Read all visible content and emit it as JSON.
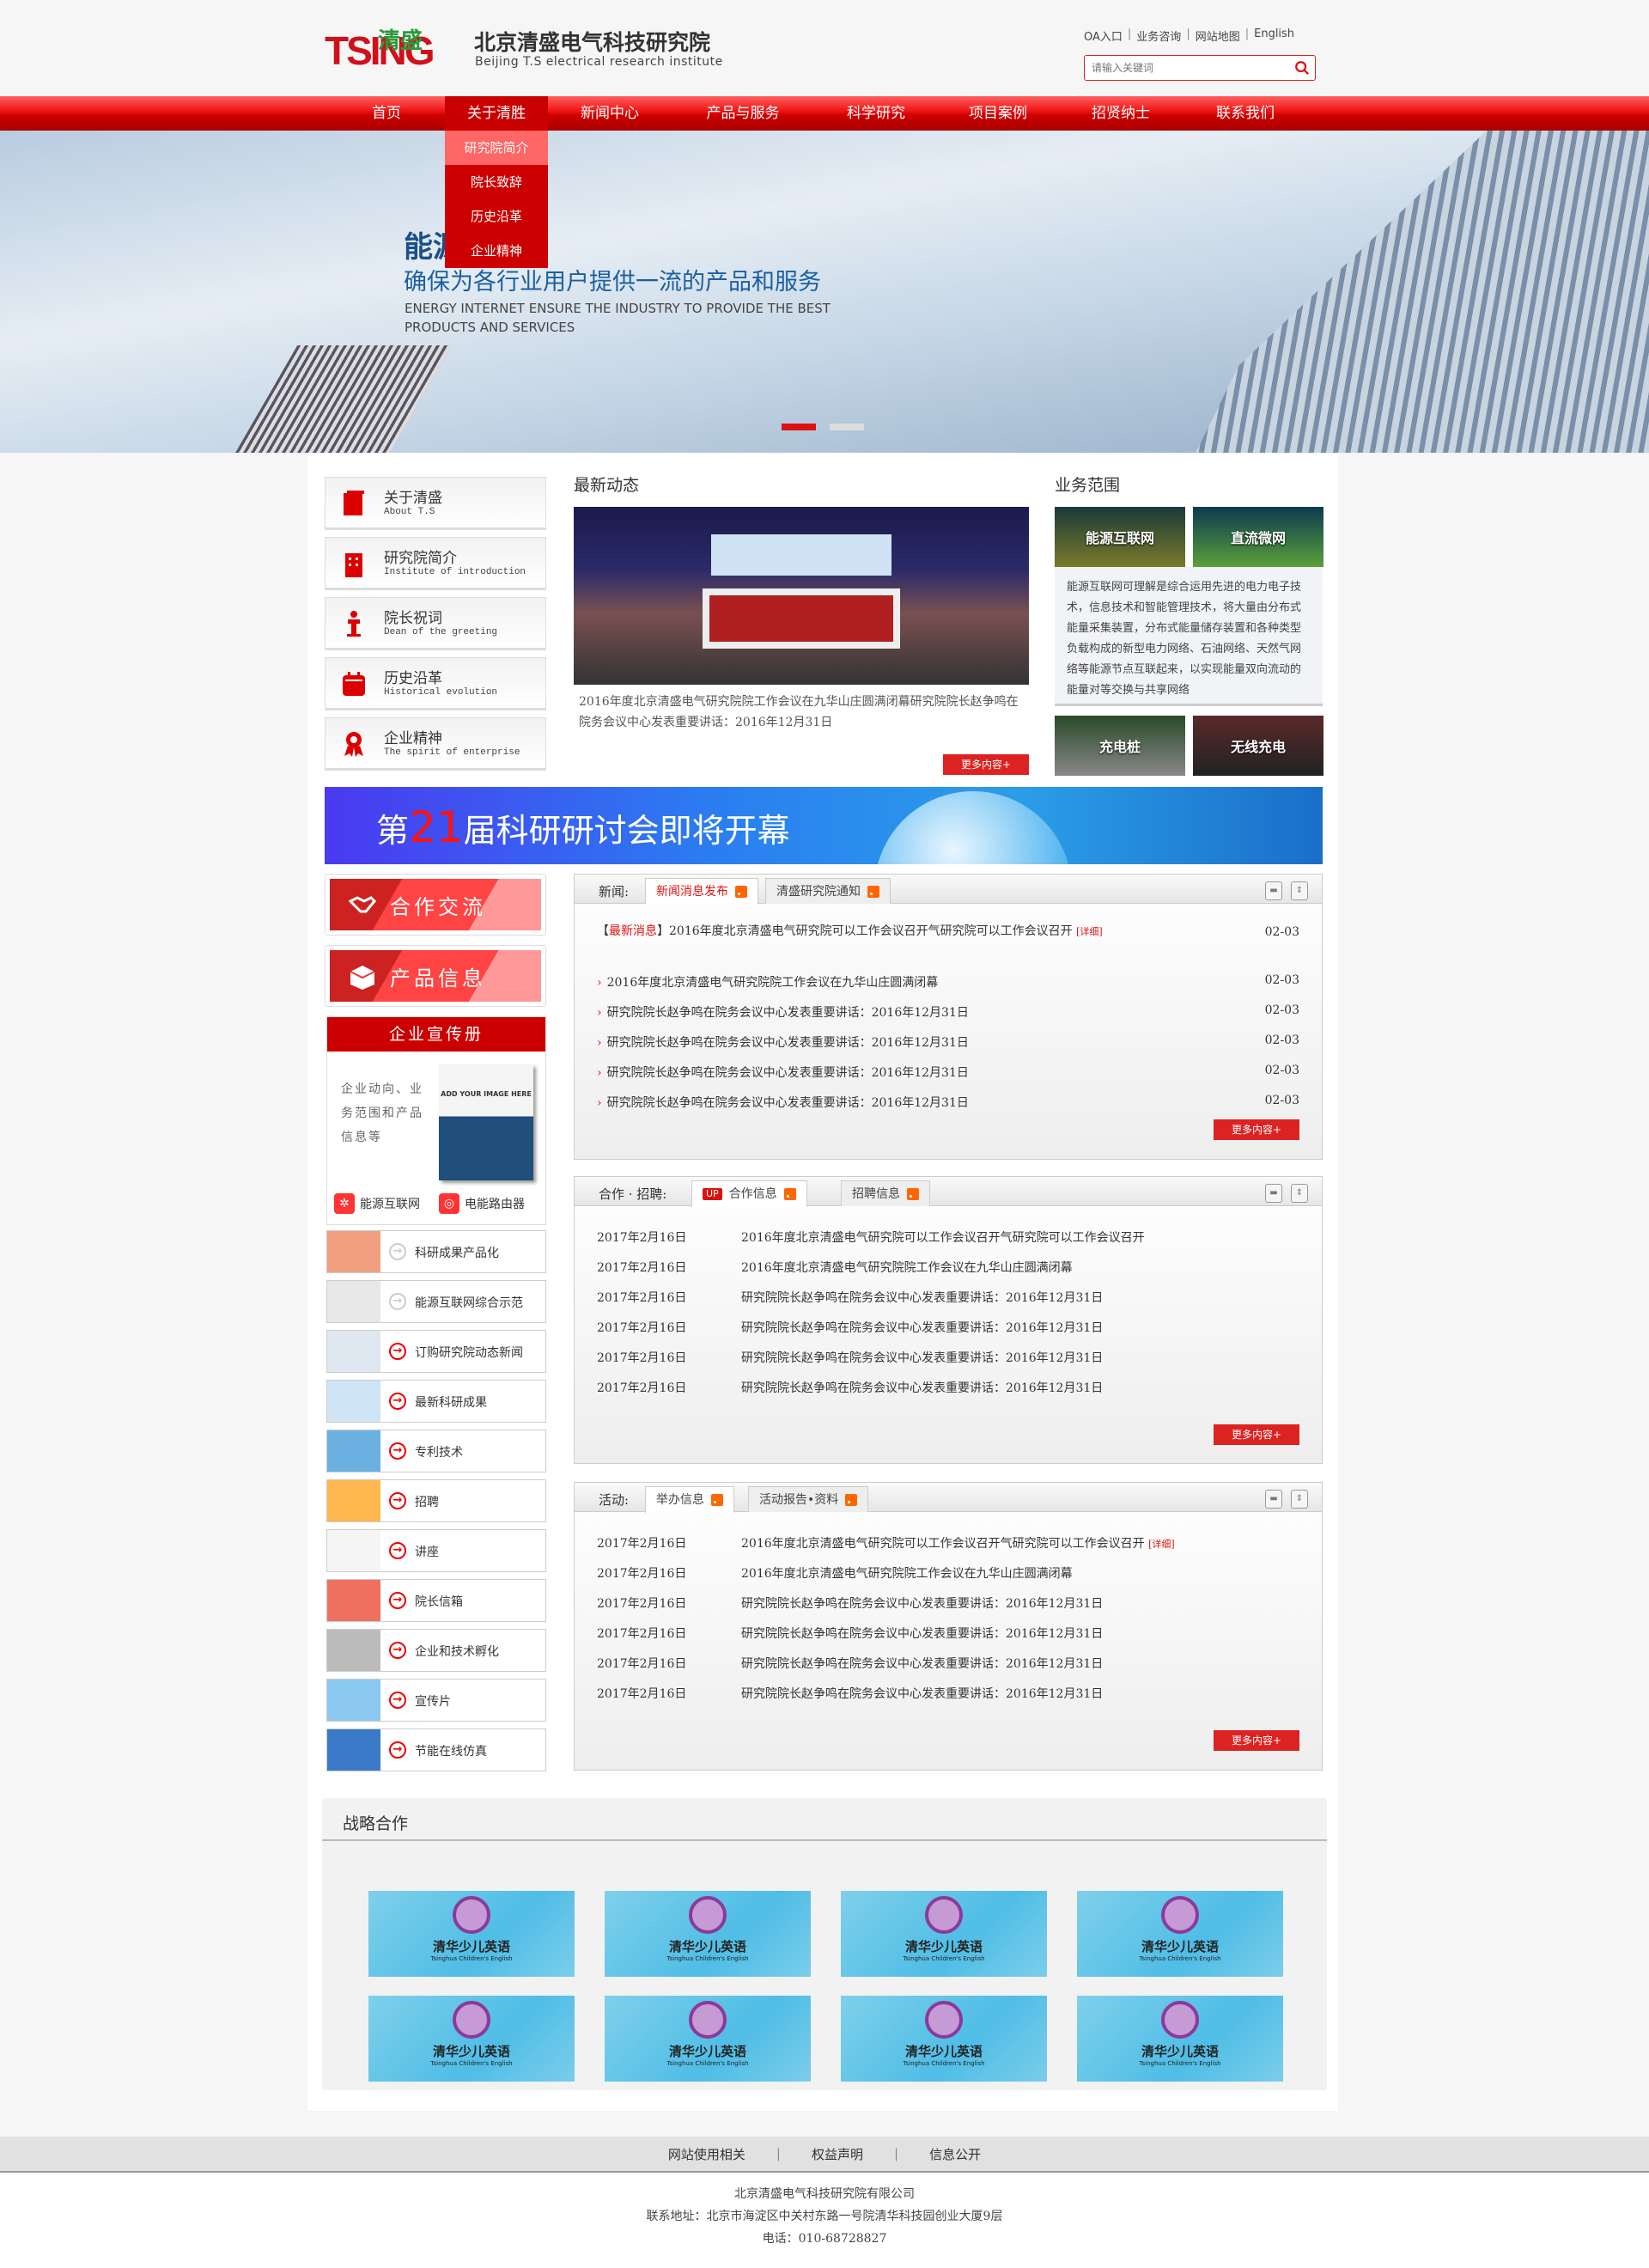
{
  "header": {
    "logo_text": "TSING 清盛",
    "brand_cn": "北京清盛电气科技研究院",
    "brand_en": "Beijing T.S  electrical  research institute",
    "top_links": [
      "OA入口",
      "业务咨询",
      "网站地图",
      "English"
    ],
    "search_placeholder": "请输入关键词"
  },
  "nav": {
    "items": [
      "首页",
      "关于清胜",
      "新闻中心",
      "产品与服务",
      "科学研究",
      "项目案例",
      "招贤纳士",
      "联系我们"
    ],
    "active": "关于清胜",
    "dropdown": [
      "研究院简介",
      "院长致辞",
      "历史沿革",
      "企业精神"
    ]
  },
  "hero": {
    "title_partial": "能源",
    "subtitle": "确保为各行业用户提供一流的产品和服务",
    "en": "ENERGY INTERNET ENSURE THE INDUSTRY TO PROVIDE THE BEST PRODUCTS AND SERVICES",
    "slides": 2,
    "active_slide": 1
  },
  "left_menu": [
    {
      "cn": "关于清盛",
      "en": "About T.S"
    },
    {
      "cn": "研究院简介",
      "en": "Institute of introduction"
    },
    {
      "cn": "院长祝词",
      "en": "Dean of the greeting"
    },
    {
      "cn": "历史沿革",
      "en": "Historical evolution"
    },
    {
      "cn": "企业精神",
      "en": "The spirit of enterprise"
    }
  ],
  "latest": {
    "title": "最新动态",
    "caption": "2016年度北京清盛电气研究院院工作会议在九华山庄圆满闭幕研究院院长赵争鸣在院务会议中心发表重要讲话：2016年12月31日",
    "more": "更多内容+"
  },
  "business": {
    "title": "业务范围",
    "tiles": [
      "能源互联网",
      "直流微网",
      "充电桩",
      "无线充电"
    ],
    "text": "能源互联网可理解是综合运用先进的电力电子技术，信息技术和智能管理技术，将大量由分布式能量采集装置，分布式能量储存装置和各种类型负载构成的新型电力网络、石油网络、天然气网络等能源节点互联起来，以实现能量双向流动的能量对等交换与共享网络"
  },
  "banner": {
    "pre": "第",
    "num": "21",
    "post": "届科研研讨会即将开幕"
  },
  "side_buttons": [
    "合作交流",
    "产品信息"
  ],
  "brochure": {
    "title": "企业宣传册",
    "desc": "企业动向、业务范围和产品信息等",
    "book_text": "ADD YOUR IMAGE HERE",
    "links": [
      "能源互联网",
      "电能路由器"
    ]
  },
  "side_list": [
    "科研成果产品化",
    "能源互联网综合示范",
    "订购研究院动态新闻",
    "最新科研成果",
    "专利技术",
    "招聘",
    "讲座",
    "院长信箱",
    "企业和技术孵化",
    "宣传片",
    "节能在线仿真"
  ],
  "news_panel": {
    "label": "新闻:",
    "tabs": [
      "新闻消息发布",
      "清盛研究院通知"
    ],
    "headline_tag": "最新消息",
    "detail": "[详细]",
    "rows": [
      {
        "t": "2016年度北京清盛电气研究院可以工作会议召开气研究院可以工作会议召开",
        "d": "02-03"
      },
      {
        "t": "2016年度北京清盛电气研究院院工作会议在九华山庄圆满闭幕",
        "d": "02-03"
      },
      {
        "t": "研究院院长赵争鸣在院务会议中心发表重要讲话：2016年12月31日",
        "d": "02-03"
      },
      {
        "t": "研究院院长赵争鸣在院务会议中心发表重要讲话：2016年12月31日",
        "d": "02-03"
      },
      {
        "t": "研究院院长赵争鸣在院务会议中心发表重要讲话：2016年12月31日",
        "d": "02-03"
      },
      {
        "t": "研究院院长赵争鸣在院务会议中心发表重要讲话：2016年12月31日",
        "d": "02-03"
      }
    ],
    "more": "更多内容+"
  },
  "coop_panel": {
    "label": "合作 · 招聘:",
    "badge": "UP",
    "tabs": [
      "合作信息",
      "招聘信息"
    ],
    "rows": [
      {
        "d": "2017年2月16日",
        "t": "2016年度北京清盛电气研究院可以工作会议召开气研究院可以工作会议召开"
      },
      {
        "d": "2017年2月16日",
        "t": "2016年度北京清盛电气研究院院工作会议在九华山庄圆满闭幕"
      },
      {
        "d": "2017年2月16日",
        "t": "研究院院长赵争鸣在院务会议中心发表重要讲话：2016年12月31日"
      },
      {
        "d": "2017年2月16日",
        "t": "研究院院长赵争鸣在院务会议中心发表重要讲话：2016年12月31日"
      },
      {
        "d": "2017年2月16日",
        "t": "研究院院长赵争鸣在院务会议中心发表重要讲话：2016年12月31日"
      },
      {
        "d": "2017年2月16日",
        "t": "研究院院长赵争鸣在院务会议中心发表重要讲话：2016年12月31日"
      }
    ],
    "more": "更多内容+"
  },
  "activity_panel": {
    "label": "活动:",
    "tabs": [
      "举办信息",
      "活动报告•资料"
    ],
    "detail": "[详细]",
    "rows": [
      {
        "d": "2017年2月16日",
        "t": "2016年度北京清盛电气研究院可以工作会议召开气研究院可以工作会议召开"
      },
      {
        "d": "2017年2月16日",
        "t": "2016年度北京清盛电气研究院院工作会议在九华山庄圆满闭幕"
      },
      {
        "d": "2017年2月16日",
        "t": "研究院院长赵争鸣在院务会议中心发表重要讲话：2016年12月31日"
      },
      {
        "d": "2017年2月16日",
        "t": "研究院院长赵争鸣在院务会议中心发表重要讲话：2016年12月31日"
      },
      {
        "d": "2017年2月16日",
        "t": "研究院院长赵争鸣在院务会议中心发表重要讲话：2016年12月31日"
      },
      {
        "d": "2017年2月16日",
        "t": "研究院院长赵争鸣在院务会议中心发表重要讲话：2016年12月31日"
      }
    ],
    "more": "更多内容+"
  },
  "strategic": {
    "title": "战略合作",
    "partner_name": "清华少儿英语",
    "partner_en": "Tsinghua Children's English",
    "count": 8
  },
  "footer": {
    "links": [
      "网站使用相关",
      "权益声明",
      "信息公开"
    ],
    "company": "北京清盛电气科技研究院有限公司",
    "address": "联系地址：北京市海淀区中关村东路一号院清华科技园创业大厦9层",
    "phone": "电话：010-68728827"
  },
  "colors": {
    "brand_red": "#cc0000",
    "accent_red": "#dd2222",
    "banner_blue": "#2a7ff0"
  }
}
